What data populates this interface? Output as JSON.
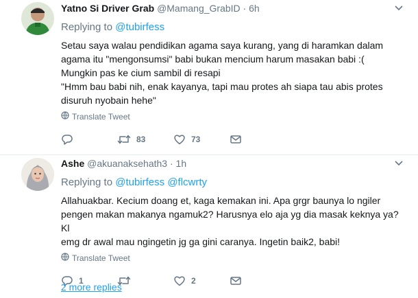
{
  "tweets": [
    {
      "name": "Yatno Si Driver Grab",
      "handle": "@Mamang_GrabID",
      "dot": "·",
      "time": "6h",
      "replying_prefix": "Replying to",
      "replying_to": [
        "@tubirfess"
      ],
      "body": [
        "Setau saya walau pendidikan agama saya kurang, yang di haramkan dalam",
        "agama itu \"mengonsumsi\" babi bukan mencium harum masakan babi :(",
        "Mungkin pas ke cium sambil di resapi",
        "\"Hmm bau babi nih, enak kayanya, tapi mau protes ah siapa tau abis protes",
        "disuruh nyobain hehe\""
      ],
      "translate_label": "Translate Tweet",
      "reply_count": "",
      "retweet_count": "83",
      "like_count": "73"
    },
    {
      "name": "Ashe",
      "handle": "@akuanaksehath3",
      "dot": "·",
      "time": "1h",
      "replying_prefix": "Replying to",
      "replying_to": [
        "@tubirfess",
        "@flcwrty"
      ],
      "body": [
        "Allahuakbar. Kecium doang et, kaga kemakan ini. Apa grgr baunya lo ngiler",
        "pengen makan makanya ngamuk2? Harusnya elo aja yg dia masak keknya ya? Kl",
        "emg dr awal mau ngingetin jg ga gini caranya. Ingetin baik2, babi!"
      ],
      "translate_label": "Translate Tweet",
      "reply_count": "1",
      "retweet_count": "",
      "like_count": "2"
    }
  ],
  "more_replies": "2 more replies",
  "colors": {
    "accent": "#1da1f2",
    "muted": "#657786",
    "text": "#14171a",
    "border": "#e6ecf0"
  }
}
